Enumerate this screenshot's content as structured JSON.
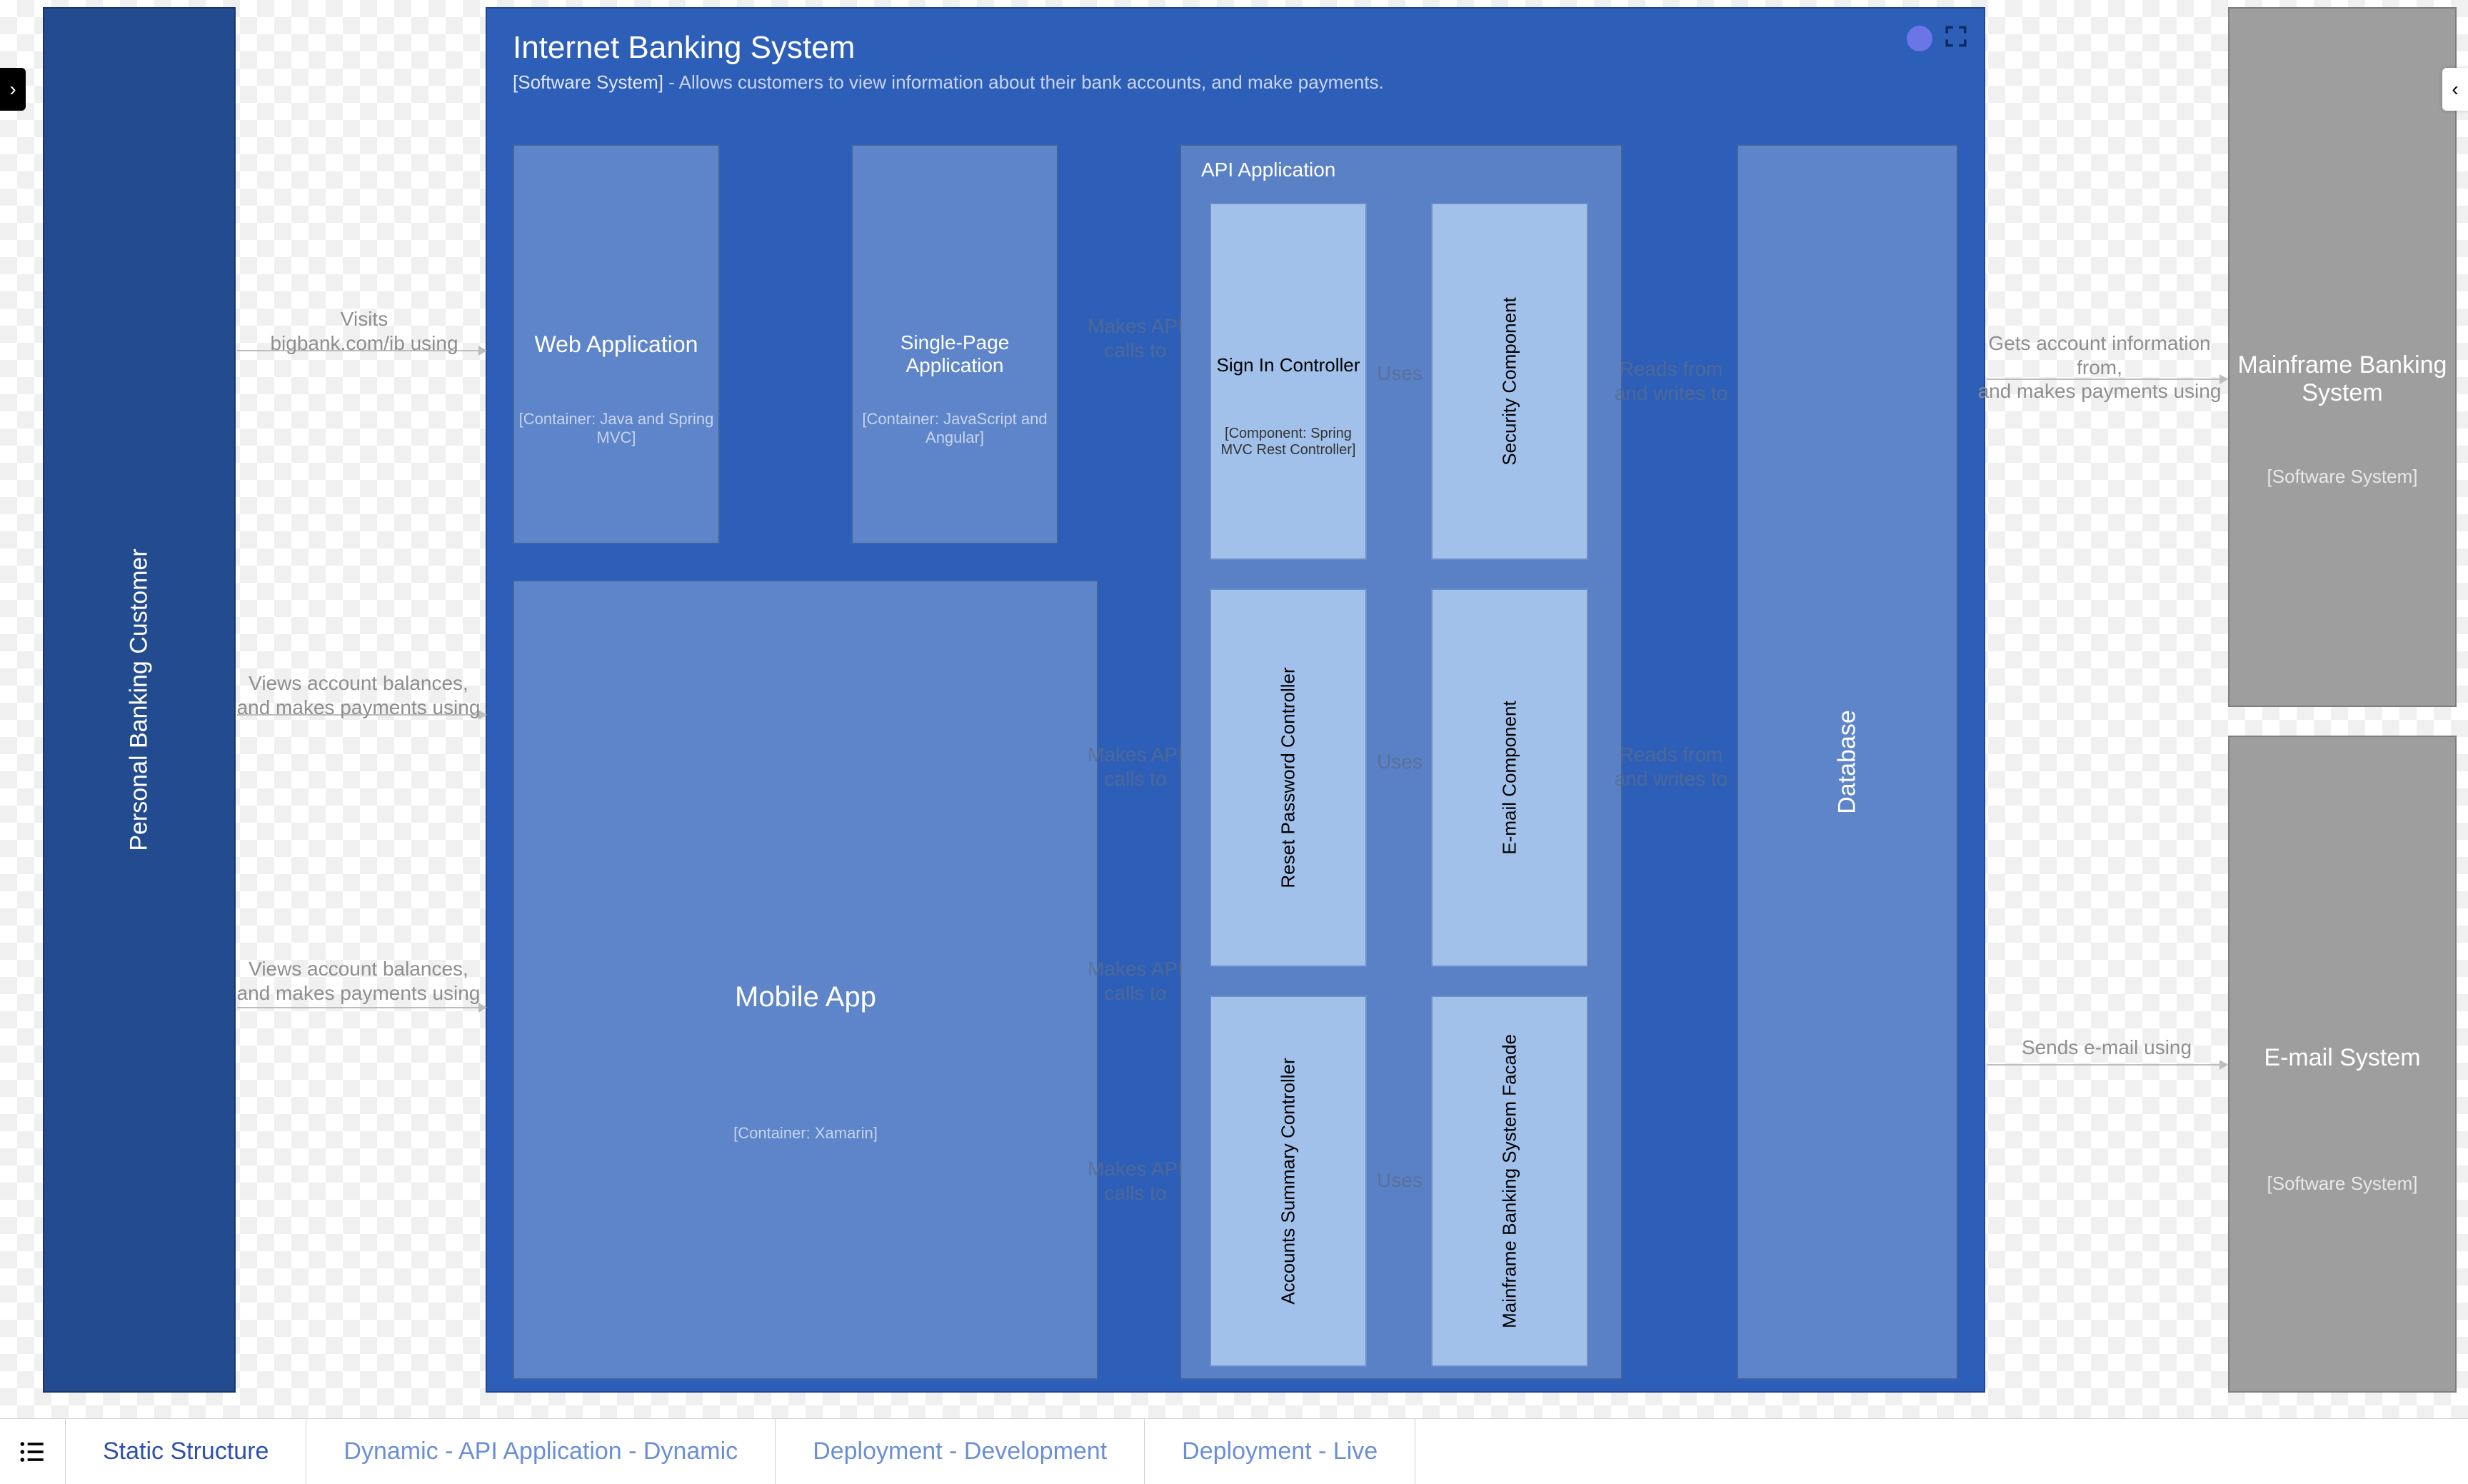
{
  "system": {
    "title": "Internet Banking System",
    "tag": "[Software System]",
    "description": "- Allows customers to view information about their bank accounts, and make payments."
  },
  "actors": {
    "customer": {
      "label": "Personal Banking Customer"
    }
  },
  "containers": {
    "web_app": {
      "label": "Web Application",
      "tech": "[Container: Java and Spring MVC]"
    },
    "spa": {
      "label": "Single-Page Application",
      "tech": "[Container: JavaScript and Angular]"
    },
    "mobile": {
      "label": "Mobile App",
      "tech": "[Container: Xamarin]"
    },
    "database": {
      "label": "Database"
    },
    "api_app": {
      "label": "API Application"
    }
  },
  "components": {
    "signin": {
      "label": "Sign In Controller",
      "tech": "[Component: Spring MVC Rest Controller]"
    },
    "reset_pwd": {
      "label": "Reset Password Controller"
    },
    "accounts_summary": {
      "label": "Accounts Summary Controller"
    },
    "security": {
      "label": "Security Component"
    },
    "email": {
      "label": "E-mail Component"
    },
    "mainframe_facade": {
      "label": "Mainframe Banking System Facade"
    }
  },
  "external": {
    "mainframe": {
      "label": "Mainframe Banking System",
      "tag": "[Software System]"
    },
    "email_system": {
      "label": "E-mail System",
      "tag": "[Software System]"
    }
  },
  "edges": {
    "visits": "Visits\nbigbank.com/ib using",
    "views1": "Views account balances,\nand makes payments using",
    "views2": "Views account balances,\nand makes payments using",
    "makes_api": "Makes API\ncalls to",
    "makes_api2": "Makes API\ncalls to",
    "makes_api3": "Makes API\ncalls to",
    "makes_api4": "Makes API\ncalls to",
    "uses": "Uses",
    "uses2": "Uses",
    "uses3": "Uses",
    "reads_writes": "Reads from\nand writes to",
    "reads_writes2": "Reads from\nand writes to",
    "gets_account": "Gets account information from,\nand makes payments using",
    "sends_email": "Sends e-mail using"
  },
  "tabs": {
    "static": "Static Structure",
    "dynamic_api": "Dynamic - API Application - Dynamic",
    "deploy_dev": "Deployment - Development",
    "deploy_live": "Deployment - Live"
  }
}
